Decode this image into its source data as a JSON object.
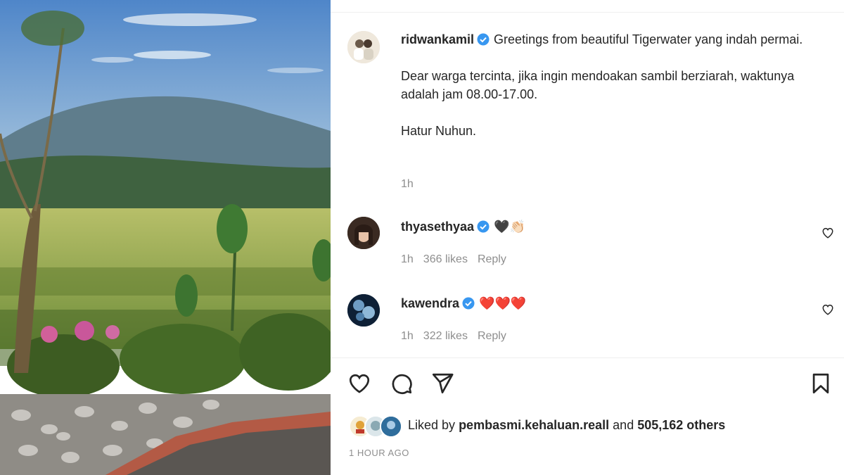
{
  "post": {
    "author": "ridwankamil",
    "caption_first": "Greetings from beautiful Tigerwater yang indah permai.",
    "caption_lines": [
      "Dear warga tercinta, jika ingin mendoakan sambil berziarah, waktunya adalah jam 08.00-17.00.",
      "Hatur Nuhun."
    ],
    "time": "1h"
  },
  "comments": [
    {
      "username": "thyasethyaa",
      "text": "🖤👏🏻",
      "time": "1h",
      "likes": "366 likes",
      "reply": "Reply"
    },
    {
      "username": "kawendra",
      "text": "❤️❤️❤️",
      "time": "1h",
      "likes": "322 likes",
      "reply": "Reply"
    }
  ],
  "likes_summary": {
    "prefix": "Liked by",
    "user": "pembasmi.kehaluan.reall",
    "middle": "and",
    "count": "505,162 others"
  },
  "timestamp": "1 HOUR AGO",
  "icons": {
    "verified": "verified-badge-icon",
    "like": "heart-icon",
    "comment": "comment-icon",
    "share": "paper-plane-icon",
    "save": "bookmark-icon",
    "comment_like": "heart-outline-icon"
  },
  "colors": {
    "verified": "#3897f0",
    "heart_emoji": "#ed2a2a",
    "muted": "#8e8e8e"
  }
}
